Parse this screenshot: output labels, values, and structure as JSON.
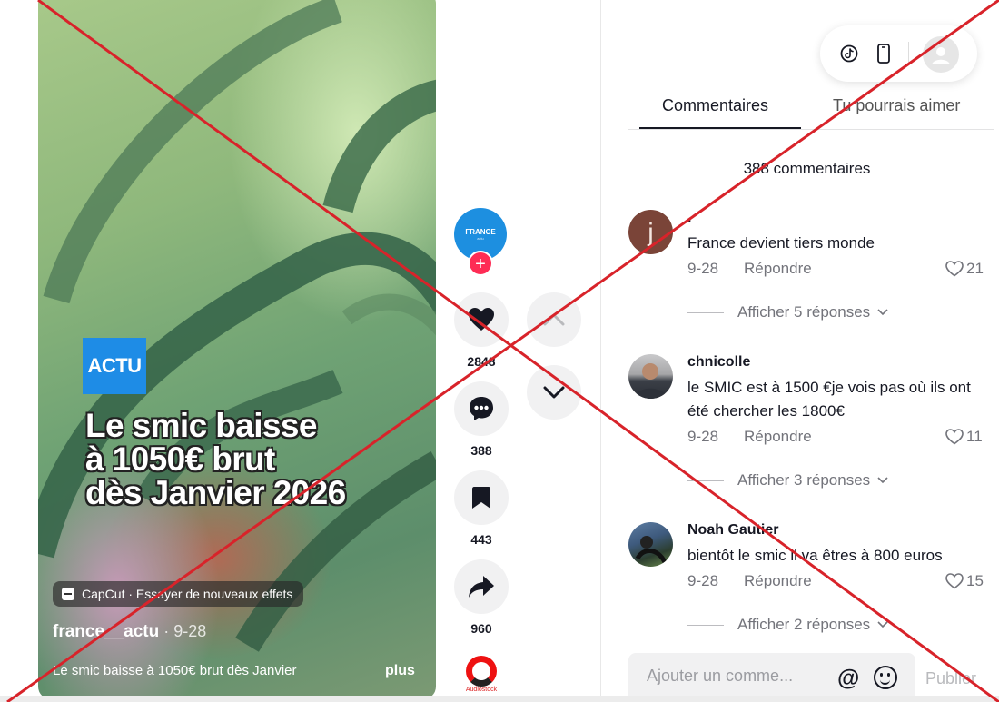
{
  "video": {
    "badge": "ACTU",
    "headline": [
      "Le smic baisse",
      "à 1050€ brut",
      "dès Janvier 2026"
    ],
    "capcut_label": "CapCut · Essayer de nouveaux effets",
    "author_handle": "france__actu",
    "author_date": " · 9-28",
    "caption": "Le smic baisse à 1050€ brut dès Janvier",
    "caption_more": "plus"
  },
  "actions": {
    "avatar_text": "FRANCE",
    "avatar_subtext": "actu",
    "follow_plus": "+",
    "likes": "2848",
    "comments": "388",
    "saves": "443",
    "shares": "960",
    "music_label": "Audiostock"
  },
  "panel": {
    "tabs": [
      "Commentaires",
      "Tu pourrais aimer"
    ],
    "comment_count": "388 commentaires",
    "comments": [
      {
        "user": ".",
        "avatar_letter": "j",
        "text": "France devient tiers monde",
        "date": "9-28",
        "reply": "Répondre",
        "likes": "21",
        "replies": "Afficher 5 réponses"
      },
      {
        "user": "chnicolle",
        "text": "le SMIC est à 1500 €je vois pas où ils ont été chercher les 1800€",
        "date": "9-28",
        "reply": "Répondre",
        "likes": "11",
        "replies": "Afficher 3 réponses"
      },
      {
        "user": "Noah Gautier",
        "text": "bientôt le smic il va êtres à 800 euros",
        "date": "9-28",
        "reply": "Répondre",
        "likes": "15",
        "replies": "Afficher 2 réponses"
      }
    ],
    "input_placeholder": "Ajouter un comme...",
    "mention_symbol": "@",
    "publish": "Publier"
  },
  "colors": {
    "accent": "#fe2c55",
    "overlay_x": "#d8232a",
    "badge_blue": "#1e8ce6"
  },
  "icons": {
    "top_bar": [
      "tiktok-icon",
      "phone-icon",
      "user-avatar-icon"
    ],
    "actions": [
      "heart-icon",
      "comment-bubble-icon",
      "bookmark-icon",
      "share-arrow-icon",
      "music-disc-icon"
    ],
    "nav": [
      "chevron-up-icon",
      "chevron-down-icon"
    ]
  }
}
